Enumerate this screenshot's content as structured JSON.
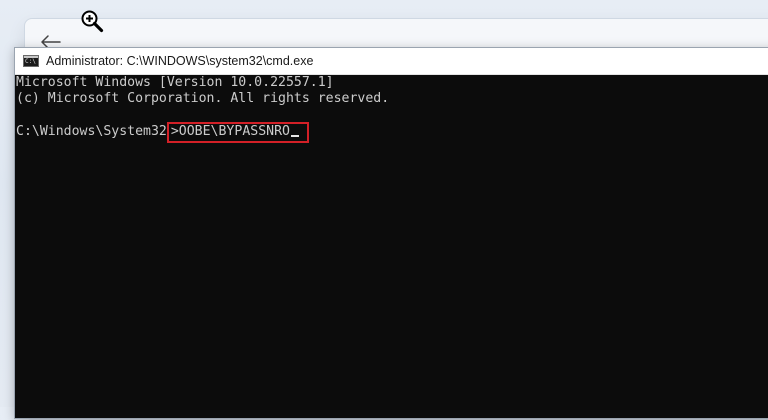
{
  "background_window": {
    "back_icon": "back-arrow-icon"
  },
  "cursor": {
    "icon": "zoom-in-cursor-icon"
  },
  "cmd": {
    "icon": "cmd-icon",
    "title": "Administrator: C:\\WINDOWS\\system32\\cmd.exe",
    "output_lines": [
      "Microsoft Windows [Version 10.0.22557.1]",
      "(c) Microsoft Corporation. All rights reserved."
    ],
    "prompt": "C:\\Windows\\System32",
    "command": ">OOBE\\BYPASSNRO",
    "highlight_color": "#d32027"
  }
}
